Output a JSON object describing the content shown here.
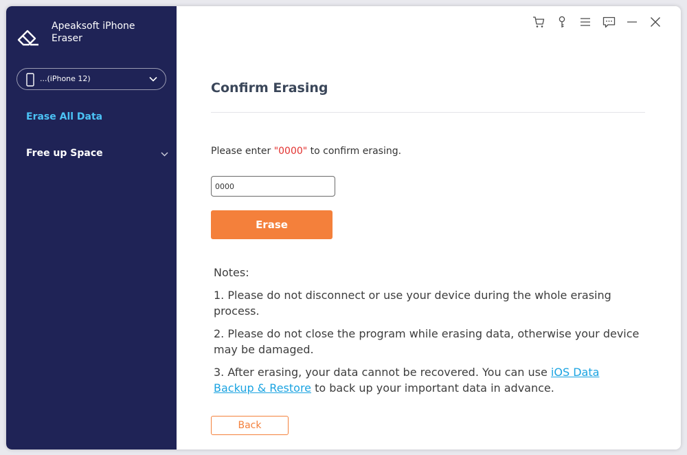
{
  "app": {
    "name": "Apeaksoft iPhone Eraser"
  },
  "device": {
    "label": "...(iPhone 12)"
  },
  "sidebar": {
    "items": [
      {
        "label": "Erase All Data",
        "active": true
      },
      {
        "label": "Free up Space",
        "active": false
      }
    ]
  },
  "toolbar": {
    "icons": [
      "cart-icon",
      "key-icon",
      "menu-icon",
      "feedback-icon",
      "minimize-icon",
      "close-icon"
    ]
  },
  "main": {
    "title": "Confirm Erasing",
    "prompt_before": "Please enter ",
    "prompt_code": "\"0000\"",
    "prompt_after": " to confirm erasing.",
    "input_value": "0000",
    "erase_label": "Erase",
    "notes_title": "Notes:",
    "note1": "1. Please do not disconnect or use your device during the whole erasing process.",
    "note2": "2. Please do not close the program while erasing data, otherwise your device may be damaged.",
    "note3_before": "3. After erasing, your data cannot be recovered. You can use ",
    "note3_link": "iOS Data Backup & Restore",
    "note3_after": " to back up your important data in advance.",
    "back_label": "Back"
  },
  "colors": {
    "sidebar_bg": "#1f2356",
    "active_nav": "#4bc2f5",
    "accent": "#f4803b",
    "code_red": "#e2312f",
    "link": "#1aa3e1"
  }
}
